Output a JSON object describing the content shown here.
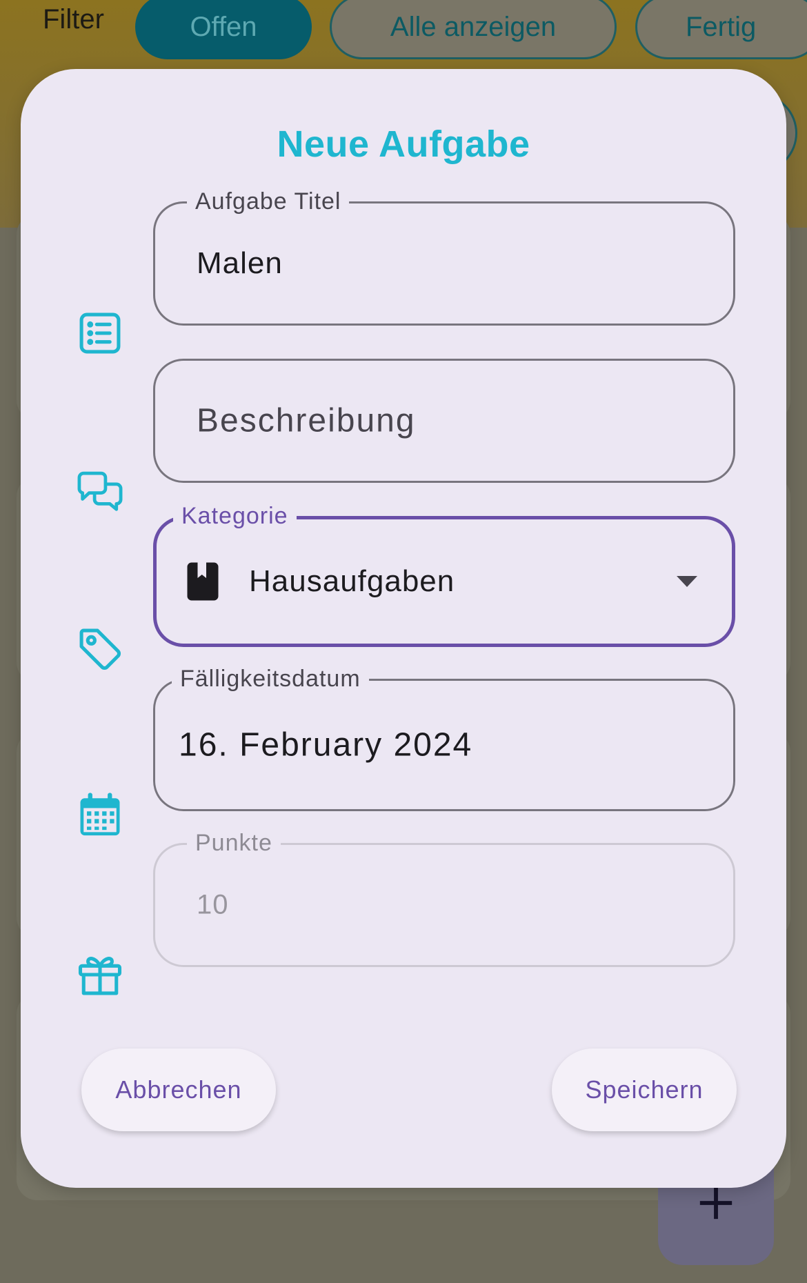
{
  "background": {
    "filter_label": "Filter",
    "chips": [
      "Offen",
      "Alle anzeigen",
      "Fertig"
    ],
    "fab_icon": "plus-icon"
  },
  "dialog": {
    "title": "Neue Aufgabe",
    "fields": {
      "title": {
        "label": "Aufgabe Titel",
        "value": "Malen",
        "icon": "list-icon"
      },
      "description": {
        "placeholder": "Beschreibung",
        "icon": "chat-bubbles-icon"
      },
      "category": {
        "label": "Kategorie",
        "value": "Hausaufgaben",
        "icon": "tag-icon",
        "value_icon": "book-icon"
      },
      "due_date": {
        "label": "Fälligkeitsdatum",
        "value": "16. February 2024",
        "icon": "calendar-icon"
      },
      "points": {
        "label": "Punkte",
        "value": "10",
        "icon": "gift-icon"
      }
    },
    "buttons": {
      "cancel": "Abbrechen",
      "save": "Speichern"
    }
  },
  "colors": {
    "accent_cyan": "#1fb6cf",
    "accent_purple": "#6a4fa8",
    "dialog_bg": "#ece7f3",
    "chip_selected": "#065c6b"
  }
}
